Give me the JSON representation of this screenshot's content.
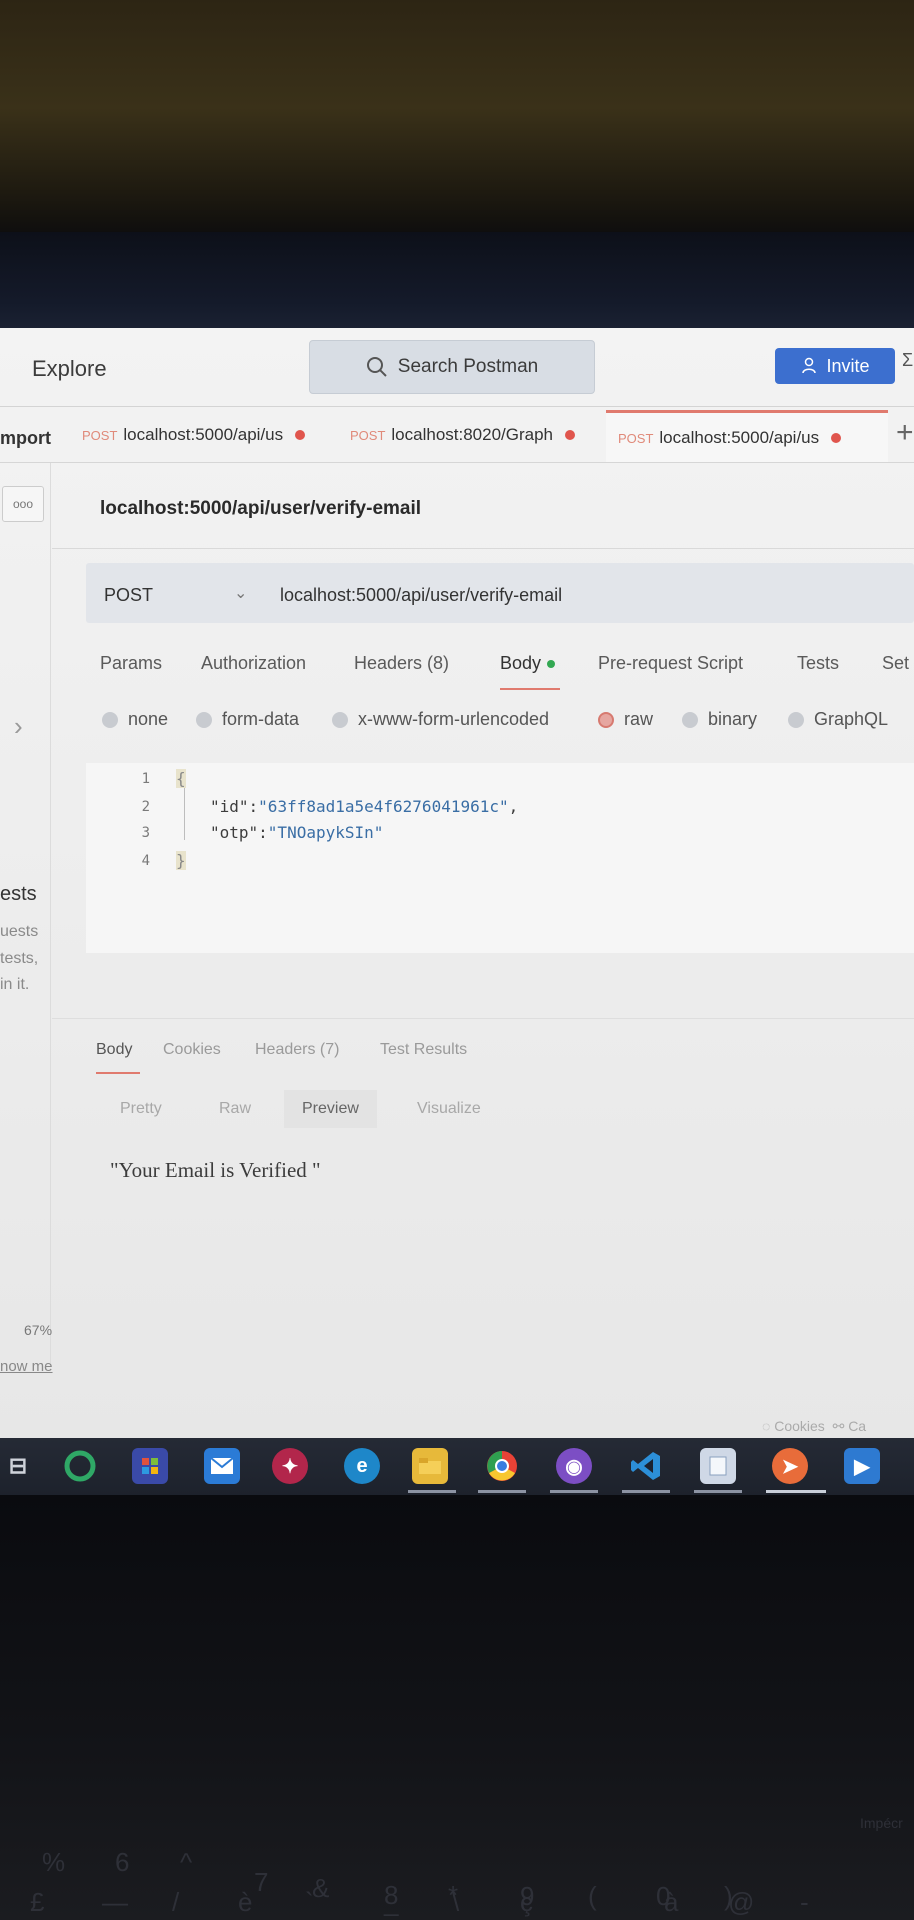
{
  "header": {
    "explore_label": "Explore",
    "search_placeholder": "Search Postman",
    "invite_label": "Invite",
    "extra_glyph": "Σ"
  },
  "sidebar": {
    "import_label": "mport",
    "ellipsis": "ooo",
    "chevron": "›",
    "empty_title": "ests",
    "empty_lines": [
      "uests",
      "tests,",
      "in it."
    ],
    "zoom": "67%",
    "show_me": "now me"
  },
  "tabs": [
    {
      "method": "POST",
      "label": "localhost:5000/api/us",
      "unsaved": true
    },
    {
      "method": "POST",
      "label": "localhost:8020/Graph",
      "unsaved": true
    },
    {
      "method": "POST",
      "label": "localhost:5000/api/us",
      "unsaved": true,
      "active": true
    }
  ],
  "tab_plus": "+",
  "request": {
    "title": "localhost:5000/api/user/verify-email",
    "method": "POST",
    "caret": "⌄",
    "url": "localhost:5000/api/user/verify-email",
    "subtabs": [
      "Params",
      "Authorization",
      "Headers (8)",
      "Body",
      "Pre-request Script",
      "Tests",
      "Set"
    ],
    "body_types": [
      "none",
      "form-data",
      "x-www-form-urlencoded",
      "raw",
      "binary",
      "GraphQL"
    ],
    "selected_body_type": "raw",
    "line_numbers": [
      "1",
      "2",
      "3",
      "4"
    ],
    "code": {
      "open_brace": "{",
      "line2_key": "\"id\":",
      "line2_value": "\"63ff8ad1a5e4f6276041961c\"",
      "line2_trail": ",",
      "line3_key": "\"otp\":",
      "line3_value": "\"TNOapykSIn\"",
      "close_brace": "}"
    }
  },
  "response": {
    "tabs": [
      "Body",
      "Cookies",
      "Headers (7)",
      "Test Results"
    ],
    "views": [
      "Pretty",
      "Raw",
      "Preview",
      "Visualize"
    ],
    "active_view": "Preview",
    "preview_text": "\"Your Email is Verified \""
  },
  "footer": {
    "cookies": "◌ Cookies",
    "extra": "⚯ Ca"
  },
  "taskbar": {
    "apps": [
      "task-view",
      "cortana",
      "store",
      "mail",
      "app-red",
      "edge",
      "file-explorer",
      "chrome",
      "github",
      "vscode",
      "app-notes",
      "postman",
      "media-player"
    ]
  },
  "keyboard": {
    "row1": [
      "%",
      "6",
      "^",
      "7",
      "&",
      "8",
      "*",
      "9",
      "(",
      "0",
      ")",
      "-"
    ],
    "row2": [
      "£",
      "—",
      "/",
      "è",
      "`",
      "_",
      "\\",
      "ç",
      "à",
      "@"
    ],
    "fn_label": "Impécr"
  },
  "colors": {
    "accent_tab": "#e07a6e",
    "invite_blue": "#3c6fcf",
    "dirty_dot": "#e0554d",
    "body_dot": "#32a852"
  }
}
